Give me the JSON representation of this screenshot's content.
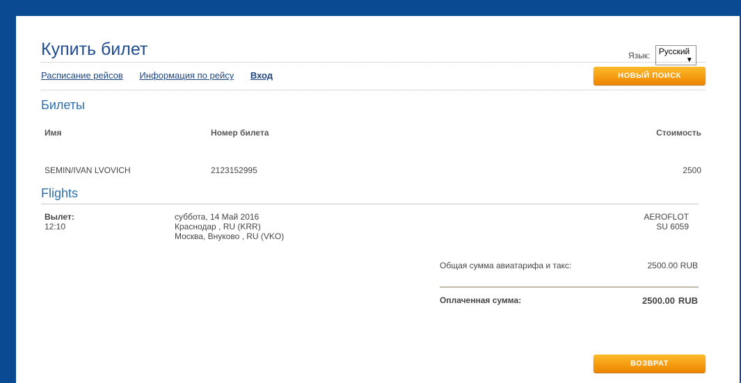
{
  "page": {
    "title": "Купить билет",
    "language_label": "Язык:",
    "language_selected": "Русский"
  },
  "nav": {
    "schedule": "Расписание рейсов",
    "flight_info": "Информация по рейсу",
    "login": "Вход",
    "new_search": "НОВЫЙ ПОИСК"
  },
  "tickets": {
    "section_title": "Билеты",
    "headers": {
      "name": "Имя",
      "number": "Номер билета",
      "price": "Стоимость"
    },
    "rows": [
      {
        "name": "SEMIN/IVAN LVOVICH",
        "number": "2123152995",
        "price": "2500"
      }
    ]
  },
  "flights": {
    "section_title": "Flights",
    "departure_label": "Вылет:",
    "departure_time": "12:10",
    "date": "суббота, 14 Май 2016",
    "origin": "Краснодар , RU (KRR)",
    "destination": "Москва, Внуково , RU (VKO)",
    "carrier": "AEROFLOT",
    "flight_number": "SU 6059"
  },
  "totals": {
    "fare_label": "Общая сумма авиатарифа и такс:",
    "fare_amount": "2500.00",
    "fare_currency": "RUB",
    "paid_label": "Оплаченная сумма:",
    "paid_amount": "2500.00",
    "paid_currency": "RUB"
  },
  "actions": {
    "refund": "ВОЗВРАТ"
  },
  "colors": {
    "frame": "#0a4a93",
    "accent_orange": "#f39c12",
    "title_blue": "#1f4c8f"
  }
}
